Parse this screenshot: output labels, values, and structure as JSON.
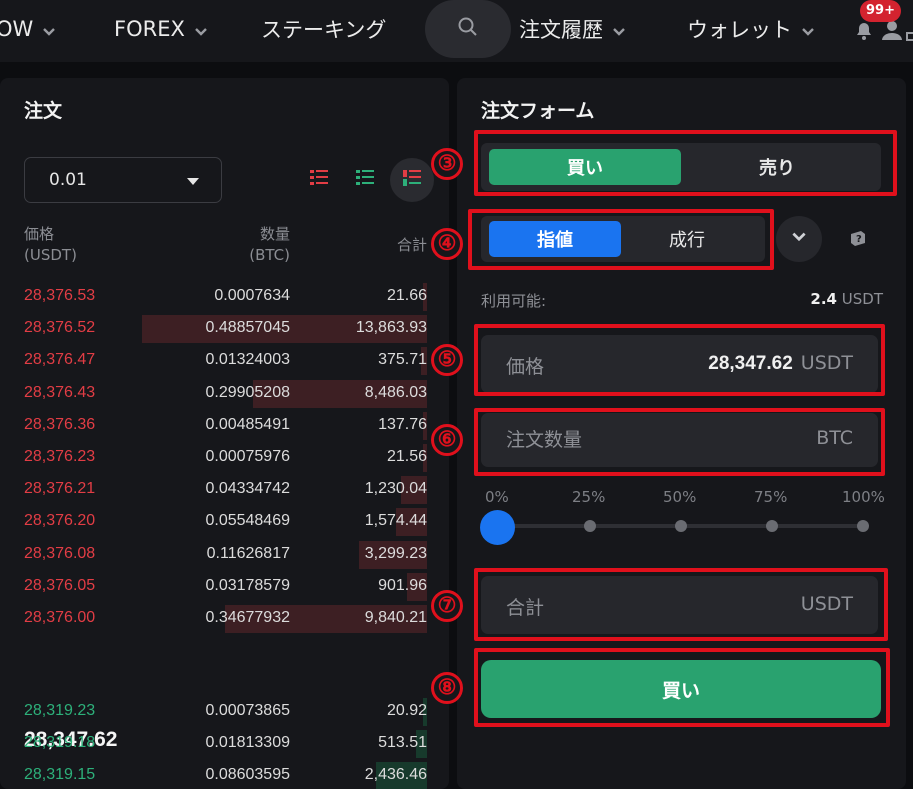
{
  "nav": {
    "items": [
      {
        "label": "OW",
        "has_chevron": true
      },
      {
        "label": "FOREX",
        "has_chevron": true
      },
      {
        "label": "ステーキング",
        "has_chevron": false
      },
      {
        "label": "注文履歴",
        "has_chevron": true
      },
      {
        "label": "ウォレット",
        "has_chevron": true
      }
    ],
    "notification_count": "99+"
  },
  "order_book": {
    "title": "注文",
    "tick_size": "0.01",
    "headers": {
      "price": "価格",
      "price_unit": "(USDT)",
      "qty": "数量",
      "qty_unit": "(BTC)",
      "total": "合計"
    },
    "asks": [
      {
        "price": "28,376.53",
        "qty": "0.0007634",
        "total": "21.66",
        "depth": 0.01
      },
      {
        "price": "28,376.52",
        "qty": "0.48857045",
        "total": "13,863.93",
        "depth": 1.0
      },
      {
        "price": "28,376.47",
        "qty": "0.01324003",
        "total": "375.71",
        "depth": 0.02
      },
      {
        "price": "28,376.43",
        "qty": "0.29905208",
        "total": "8,486.03",
        "depth": 0.61
      },
      {
        "price": "28,376.36",
        "qty": "0.00485491",
        "total": "137.76",
        "depth": 0.01
      },
      {
        "price": "28,376.23",
        "qty": "0.00075976",
        "total": "21.56",
        "depth": 0.01
      },
      {
        "price": "28,376.21",
        "qty": "0.04334742",
        "total": "1,230.04",
        "depth": 0.09
      },
      {
        "price": "28,376.20",
        "qty": "0.05548469",
        "total": "1,574.44",
        "depth": 0.11
      },
      {
        "price": "28,376.08",
        "qty": "0.11626817",
        "total": "3,299.23",
        "depth": 0.24
      },
      {
        "price": "28,376.05",
        "qty": "0.03178579",
        "total": "901.96",
        "depth": 0.07
      },
      {
        "price": "28,376.00",
        "qty": "0.34677932",
        "total": "9,840.21",
        "depth": 0.71
      }
    ],
    "last_price": "28,347.62",
    "bids": [
      {
        "price": "28,319.23",
        "qty": "0.00073865",
        "total": "20.92",
        "depth": 0.01
      },
      {
        "price": "28,319.18",
        "qty": "0.01813309",
        "total": "513.51",
        "depth": 0.04
      },
      {
        "price": "28,319.15",
        "qty": "0.08603595",
        "total": "2,436.46",
        "depth": 0.18
      }
    ],
    "colors": {
      "ask": "#e23d45",
      "bid": "#2db07a",
      "ask_bar": "#3d1f23",
      "bid_bar": "#173a2c"
    }
  },
  "order_form": {
    "title": "注文フォーム",
    "side_buy": "買い",
    "side_sell": "売り",
    "type_limit": "指値",
    "type_market": "成行",
    "available_label": "利用可能:",
    "available_value": "2.4",
    "available_unit": "USDT",
    "price_label": "価格",
    "price_value": "28,347.62",
    "price_unit": "USDT",
    "amount_label": "注文数量",
    "amount_unit": "BTC",
    "percentages": [
      "0%",
      "25%",
      "50%",
      "75%",
      "100%"
    ],
    "slider_value": 0,
    "total_label": "合計",
    "total_unit": "USDT",
    "submit_label": "買い",
    "colors": {
      "buy": "#29a26f",
      "limit_active": "#1a74f0",
      "annotation": "#e0101c"
    }
  },
  "annotations": [
    "③",
    "④",
    "⑤",
    "⑥",
    "⑦",
    "⑧"
  ],
  "icons": [
    "chevron-down-icon",
    "search-icon",
    "bell-icon",
    "user-icon",
    "orderbook-both-icon",
    "orderbook-bids-icon",
    "orderbook-asks-icon",
    "dropdown-caret-icon",
    "help-icon"
  ]
}
